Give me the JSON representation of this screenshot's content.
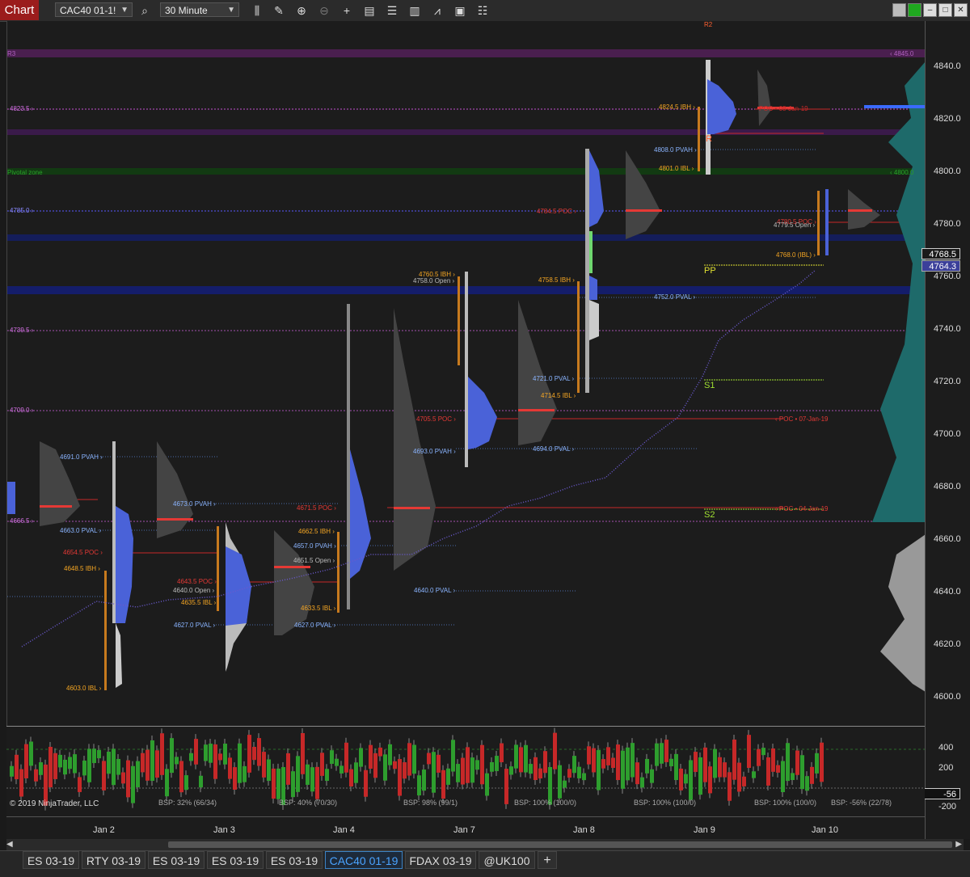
{
  "toolbar": {
    "chart_tab": "Chart",
    "instrument": "CAC40 01-1!",
    "interval": "30 Minute",
    "icons": [
      "search-icon",
      "bar-type-icon",
      "drawing-tool-icon",
      "zoom-in-icon",
      "zoom-out-icon",
      "crosshair-icon",
      "data-box-icon",
      "properties-icon",
      "strategies-icon",
      "indicators-icon",
      "templates-icon",
      "more-icon"
    ]
  },
  "axis": {
    "ticks": [
      "4840.0",
      "4820.0",
      "4800.0",
      "4780.0",
      "4760.0",
      "4740.0",
      "4720.0",
      "4700.0",
      "4680.0",
      "4660.0",
      "4640.0",
      "4620.0",
      "4600.0"
    ],
    "price_tags": {
      "last": "4768.5",
      "current": "4764.3"
    },
    "ind_ticks": [
      "400",
      "200",
      "-56",
      "-200"
    ],
    "ind_tag": "-56"
  },
  "xaxis": [
    "Jan 2",
    "Jan 3",
    "Jan 4",
    "Jan 7",
    "Jan 8",
    "Jan 9",
    "Jan 10"
  ],
  "levels": {
    "r3": "R3",
    "r2": "R2",
    "pivotal_zone": "Pivotal zone",
    "pp": "PP",
    "s1": "S1",
    "s2": "S2",
    "l_4845": "‹ 4845.0",
    "l_4800": "‹ 4800.0",
    "left_4823": "4823.5 ›",
    "left_4785": "4785.0 ›",
    "left_4739": "4739.5 ›",
    "left_4709": "4709.0 ›",
    "left_4666": "4666.5 ›",
    "ibh_4824": "4824.5 IBH ›",
    "poc_prev": "POC • 08-Jan-19",
    "pvah_4808": "4808.0 PVAH ›",
    "ibl_4801": "4801.0 IBL ›",
    "r_label": "R",
    "poc_4784": "4784.5 POC ›",
    "poc_4780": "4780.5 POC ›",
    "open_4779": "4779.5 Open ›",
    "ibl_4768": "4768.0 (IBL) ›",
    "ibh_4760": "4760.5 IBH ›",
    "open_4758": "4758.0 Open ›",
    "ibh_4758": "4758.5 IBH ›",
    "pval_4752": "4752.0 PVAL ›",
    "pval_4721": "4721.0 PVAL ›",
    "ibl_4714": "4714.5 IBL ›",
    "poc_4705": "4705.5 POC ›",
    "poc_07": "‹ POC • 07-Jan-19",
    "pvah_4693": "4693.0 PVAH ›",
    "pval_4694": "4694.0 PVAL ›",
    "pvah_4691": "4691.0 PVAH ›",
    "pvah_4673": "4673.0 PVAH ›",
    "poc_4671": "4671.5 POC ›",
    "poc_04": "‹ POC • 04-Jan-19",
    "pval_4663": "4663.0 PVAL ›",
    "ibh_4662": "4662.5 IBH ›",
    "pvah_4657": "4657.0 PVAH ›",
    "poc_4654": "4654.5 POC ›",
    "open_4651": "4651.5 Open ›",
    "ibh_4648": "4648.5 IBH ›",
    "poc_4643": "4643.5 POC ›",
    "open_4640": "4640.0 Open ›",
    "ibl_4635": "4635.5 IBL ›",
    "ibl_4633": "4633.5 IBL ›",
    "pval_4640": "4640.0 PVAL ›",
    "pval_4627a": "4627.0 PVAL ›",
    "pval_4627b": "4627.0 PVAL ›",
    "ibl_4603": "4603.0 IBL ›"
  },
  "indicator": {
    "copyright": "© 2019 NinjaTrader, LLC",
    "bsp": [
      "BSP: 32% (66/34)",
      "BSP: 40% (70/30)",
      "BSP: 98% (99/1)",
      "BSP: 100% (100/0)",
      "BSP: 100% (100/0)",
      "BSP: 100% (100/0)",
      "BSP: -56% (22/78)"
    ]
  },
  "tabs": [
    "ES 03-19",
    "RTY 03-19",
    "ES 03-19",
    "ES 03-19",
    "ES 03-19",
    "CAC40 01-19",
    "FDAX 03-19",
    "@UK100",
    "+"
  ],
  "colors": {
    "up": "#2e9e2e",
    "down": "#c62828",
    "poc": "#e53935",
    "ib": "#f5a623",
    "va": "#6fa8ff",
    "profile_blue": "#3f5fe0",
    "profile_gray": "#9e9e9e",
    "vwap": "#6a5acd"
  }
}
